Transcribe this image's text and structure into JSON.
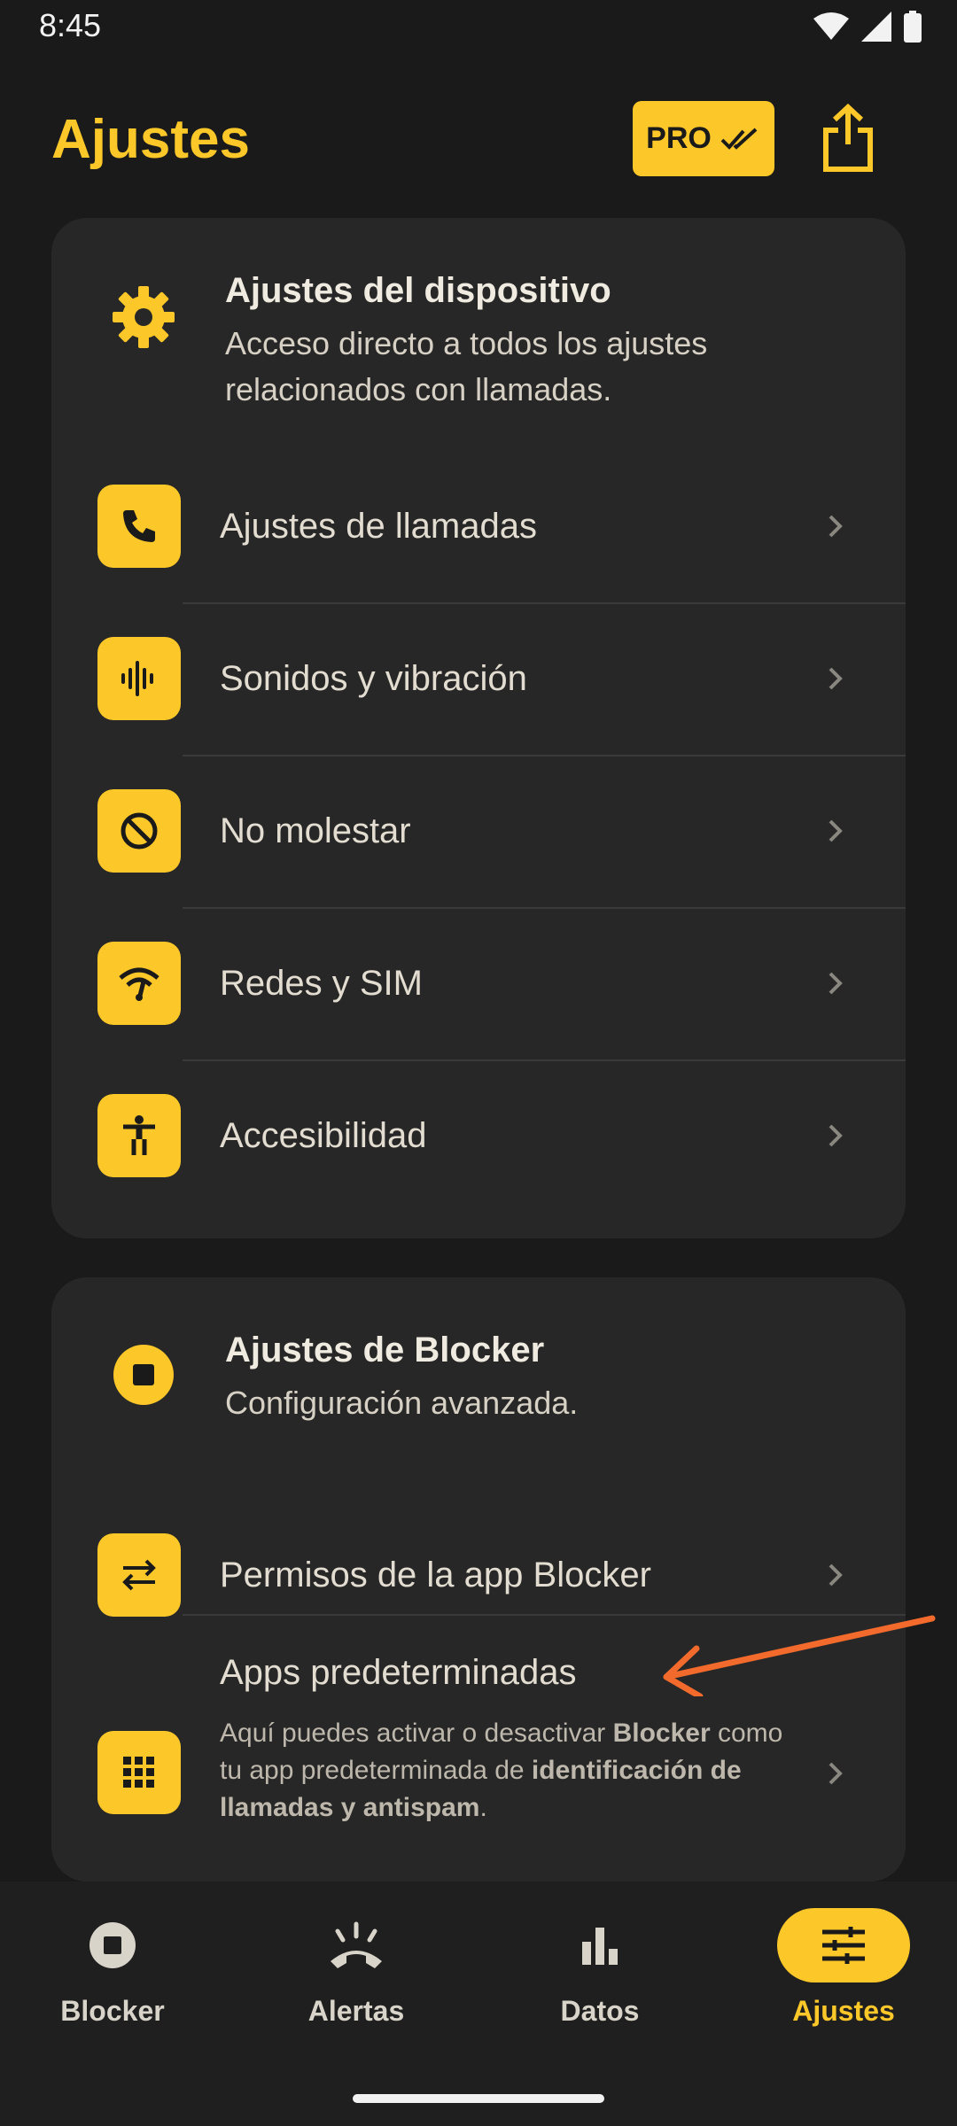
{
  "status": {
    "time": "8:45"
  },
  "header": {
    "title": "Ajustes",
    "pro_label": "PRO"
  },
  "device_settings": {
    "title": "Ajustes del dispositivo",
    "subtitle": "Acceso directo a todos los ajustes relacionados con llamadas.",
    "items": [
      {
        "label": "Ajustes de llamadas",
        "icon": "phone-icon"
      },
      {
        "label": "Sonidos y vibración",
        "icon": "sound-wave-icon"
      },
      {
        "label": "No molestar",
        "icon": "do-not-disturb-icon"
      },
      {
        "label": "Redes y SIM",
        "icon": "network-icon"
      },
      {
        "label": "Accesibilidad",
        "icon": "accessibility-icon"
      }
    ]
  },
  "blocker_settings": {
    "title": "Ajustes de Blocker",
    "subtitle": "Configuración avanzada.",
    "permissions_label": "Permisos de la app Blocker",
    "default_apps": {
      "label": "Apps predeterminadas",
      "desc_1": "Aquí puedes activar o desactivar ",
      "desc_2": "Blocker",
      "desc_3": " como tu app predeterminada de ",
      "desc_4": "identificación de llamadas y antispam",
      "desc_5": "."
    }
  },
  "nav": {
    "items": [
      {
        "label": "Blocker"
      },
      {
        "label": "Alertas"
      },
      {
        "label": "Datos"
      },
      {
        "label": "Ajustes"
      }
    ]
  },
  "colors": {
    "accent": "#fcc729",
    "background": "#1a1a1a",
    "card": "#272727",
    "annotation": "#f26a2c"
  }
}
